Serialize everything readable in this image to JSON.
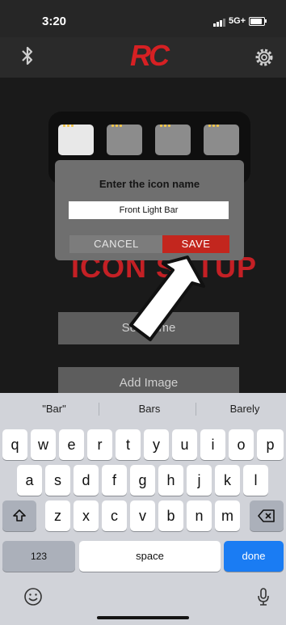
{
  "status_bar": {
    "time": "3:20",
    "network": "5G+"
  },
  "app": {
    "logo": "RC",
    "bluetooth_icon": "bluetooth-icon",
    "settings_icon": "gear-icon"
  },
  "background": {
    "heading": "ICON SETUP",
    "set_name_label": "Set Name",
    "add_image_label": "Add Image"
  },
  "dialog": {
    "title": "Enter the icon name",
    "input_value": "Front Light Bar",
    "cancel_label": "CANCEL",
    "save_label": "SAVE"
  },
  "annotation": {
    "arrow_color": "#ffffff",
    "arrow_target": "save-button"
  },
  "keyboard": {
    "suggestions": [
      "\"Bar\"",
      "Bars",
      "Barely"
    ],
    "row1": [
      "q",
      "w",
      "e",
      "r",
      "t",
      "y",
      "u",
      "i",
      "o",
      "p"
    ],
    "row2": [
      "a",
      "s",
      "d",
      "f",
      "g",
      "h",
      "j",
      "k",
      "l"
    ],
    "row3": [
      "z",
      "x",
      "c",
      "v",
      "b",
      "n",
      "m"
    ],
    "numbers_label": "123",
    "space_label": "space",
    "done_label": "done"
  },
  "colors": {
    "brand_red": "#d62023",
    "save_red": "#c3261e",
    "done_blue": "#1a7cf3"
  }
}
